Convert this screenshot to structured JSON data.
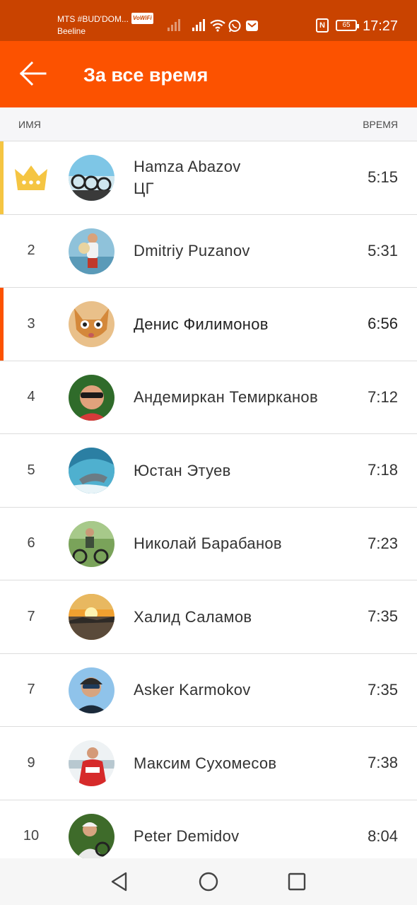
{
  "status_bar": {
    "carrier_line1": "MTS #BUD'DOM...",
    "carrier_badge": "VoWiFi",
    "carrier_line2": "Beeline",
    "battery": "65",
    "nfc": "N",
    "time": "17:27"
  },
  "app_bar": {
    "title": "За все время",
    "back_icon": "arrow-left-icon"
  },
  "columns": {
    "name": "ИМЯ",
    "time": "ВРЕМЯ"
  },
  "colors": {
    "brand_orange": "#fc5200",
    "status_bar": "#c94300",
    "gold": "#f5c542"
  },
  "leaderboard": [
    {
      "rank": "1",
      "icon": "crown-icon",
      "name": "Hamza Abazov\nЦГ",
      "time": "5:15"
    },
    {
      "rank": "2",
      "name": "Dmitriy Puzanov",
      "time": "5:31"
    },
    {
      "rank": "3",
      "name": "Денис Филимонов",
      "time": "6:56",
      "current_user": true
    },
    {
      "rank": "4",
      "name": "Андемиркан Темирканов",
      "time": "7:12"
    },
    {
      "rank": "5",
      "name": "Юстан Этуев",
      "time": "7:18"
    },
    {
      "rank": "6",
      "name": "Николай Барабанов",
      "time": "7:23"
    },
    {
      "rank": "7",
      "name": "Халид Саламов",
      "time": "7:35"
    },
    {
      "rank": "7",
      "name": "Asker Karmokov",
      "time": "7:35"
    },
    {
      "rank": "9",
      "name": "Максим Сухомесов",
      "time": "7:38"
    },
    {
      "rank": "10",
      "name": "Peter Demidov",
      "time": "8:04"
    }
  ]
}
